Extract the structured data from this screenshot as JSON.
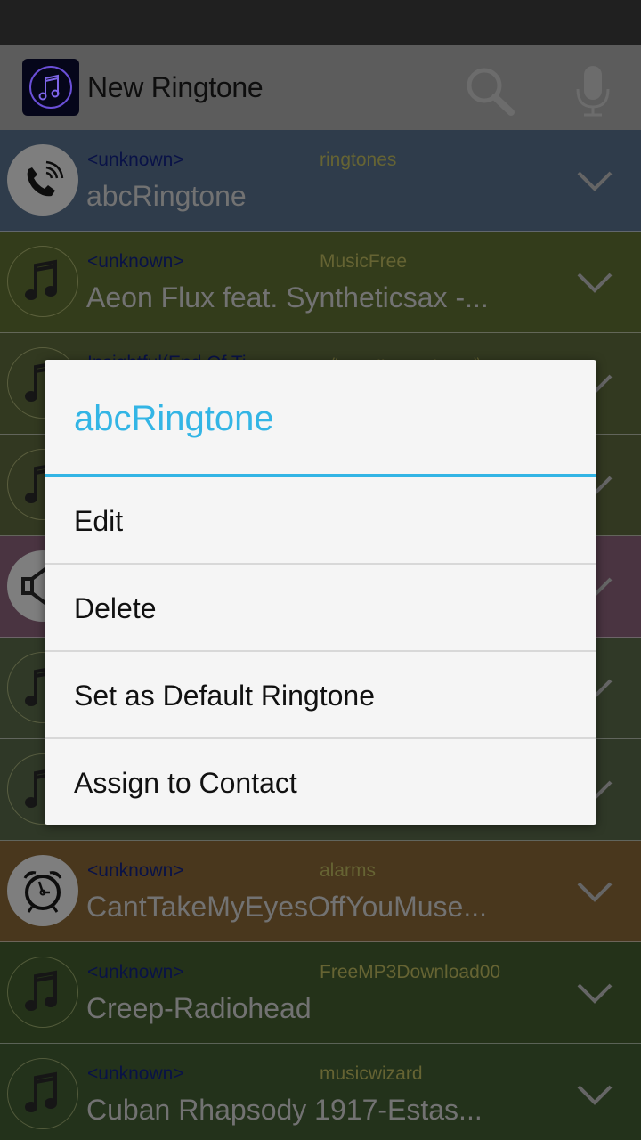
{
  "action_bar": {
    "title": "New Ringtone",
    "icons": [
      "app-music-note-icon",
      "search-icon",
      "microphone-icon"
    ]
  },
  "list": {
    "rows": [
      {
        "artist": "<unknown>",
        "folder": "ringtones",
        "title": "abcRingtone",
        "icon": "phone-ringing-icon",
        "bg": "#3a4a5c"
      },
      {
        "artist": "<unknown>",
        "folder": "MusicFree",
        "title": "Aeon Flux feat. Syntheticsax -...",
        "icon": "music-note-icon",
        "bg": "#3f4a22"
      },
      {
        "artist": "Insightful(End Of Ti",
        "folder": "《Feadle Package》",
        "title": "",
        "icon": "music-note-icon",
        "bg": "#3d4628"
      },
      {
        "artist": "",
        "folder": "",
        "title": "",
        "icon": "music-note-icon",
        "bg": "#3e4529"
      },
      {
        "artist": "",
        "folder": "",
        "title": "",
        "icon": "speaker-icon",
        "bg": "#5b4050"
      },
      {
        "artist": "",
        "folder": "",
        "title": "",
        "icon": "music-note-icon",
        "bg": "#3b4630"
      },
      {
        "artist": "",
        "folder": "",
        "title": "",
        "icon": "music-note-icon",
        "bg": "#3a4530"
      },
      {
        "artist": "<unknown>",
        "folder": "alarms",
        "title": "CantTakeMyEyesOffYouMuse...",
        "icon": "alarm-clock-icon",
        "bg": "#5a4424"
      },
      {
        "artist": "<unknown>",
        "folder": "FreeMP3Download00",
        "title": "Creep-Radiohead",
        "icon": "music-note-icon",
        "bg": "#2c3e1f"
      },
      {
        "artist": "<unknown>",
        "folder": "musicwizard",
        "title": "Cuban Rhapsody 1917-Estas...",
        "icon": "music-note-icon",
        "bg": "#2b3d22"
      }
    ]
  },
  "dialog": {
    "title": "abcRingtone",
    "items": [
      "Edit",
      "Delete",
      "Set as Default Ringtone",
      "Assign to Contact"
    ]
  },
  "colors": {
    "accent": "#33b5e5",
    "scrim": "rgba(0,0,0,0.55)"
  }
}
